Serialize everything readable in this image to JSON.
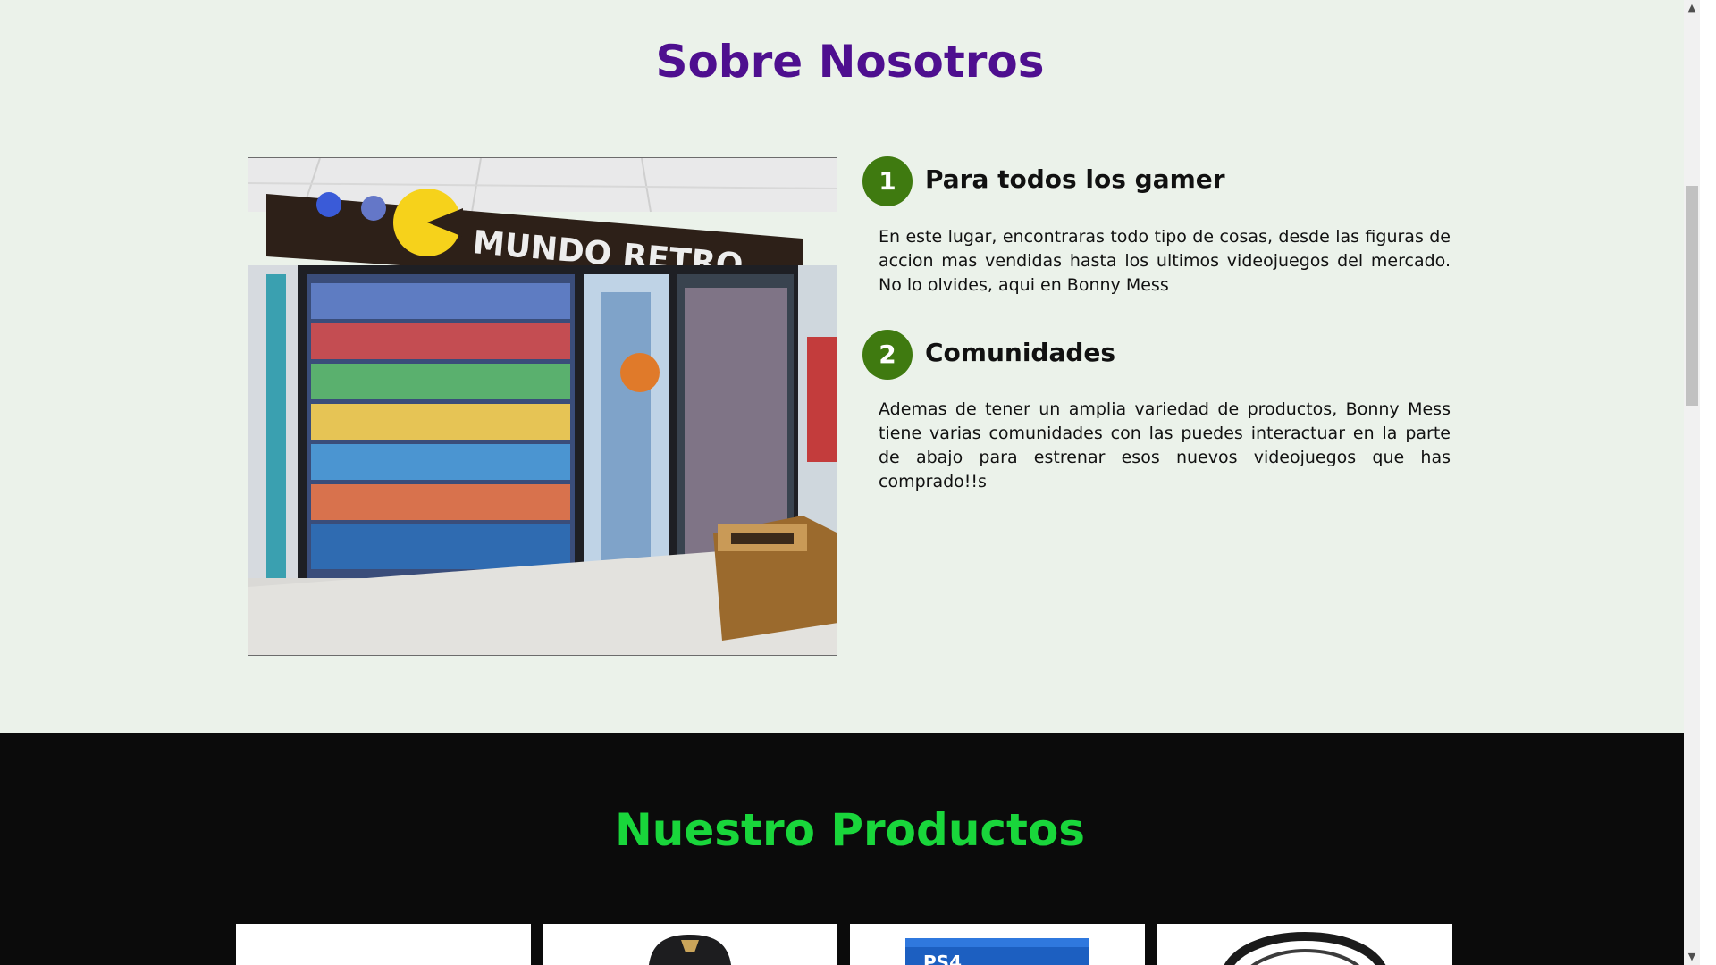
{
  "about": {
    "title": "Sobre Nosotros",
    "photo_alt": "Tienda Mundo Retro - videojuegos consolas y accesorios",
    "features": [
      {
        "number": "1",
        "title": "Para todos los gamer",
        "text": "En este lugar, encontraras todo tipo de cosas, desde las figuras de accion mas vendidas hasta los ultimos videojuegos del mercado. No lo olvides, aqui en Bonny Mess"
      },
      {
        "number": "2",
        "title": "Comunidades",
        "text": "Ademas de tener un amplia variedad de productos, Bonny Mess tiene varias comunidades con las puedes interactuar en la parte de abajo para estrenar esos nuevos videojuegos que has comprado!!s"
      }
    ]
  },
  "products": {
    "title": "Nuestro Productos",
    "items": [
      {
        "image": "blank-product-image"
      },
      {
        "image": "gaming-chair-image"
      },
      {
        "image": "ps4-game-case-image"
      },
      {
        "image": "headset-cable-image"
      }
    ]
  },
  "scrollbar": {
    "up_icon": "▲",
    "down_icon": "▼"
  },
  "colors": {
    "about_bg": "#ebf2ea",
    "about_title": "#4e0f8f",
    "feature_badge": "#3f7a10",
    "products_bg": "#0b0b0b",
    "products_title": "#19d63b"
  }
}
